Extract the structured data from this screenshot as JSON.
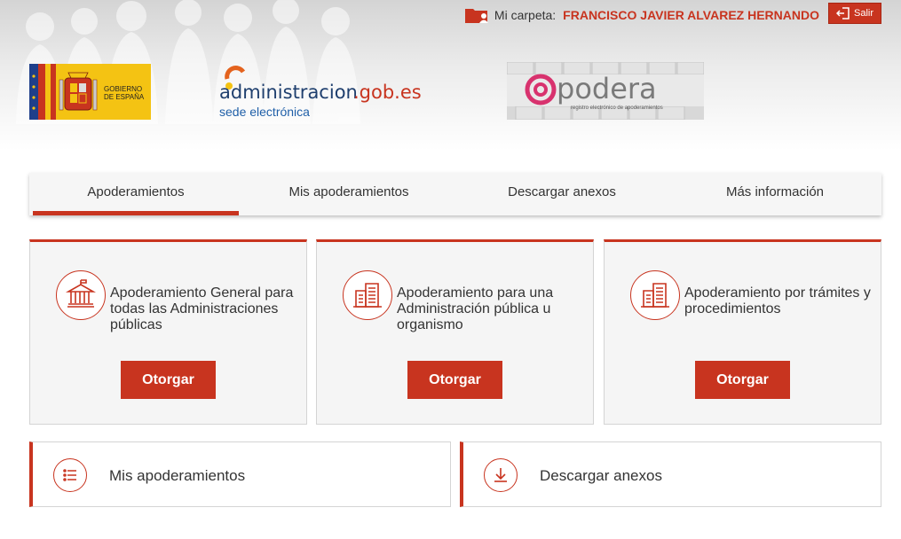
{
  "header": {
    "folder_label": "Mi carpeta:",
    "user_name": "FRANCISCO JAVIER ALVAREZ HERNANDO",
    "logout_label": "Salir"
  },
  "logos": {
    "gobierno_line1": "GOBIERNO",
    "gobierno_line2": "DE ESPAÑA",
    "admin_main": "administracion",
    "admin_domain": ".gob.es",
    "admin_sub": "sede electrónica",
    "apodera_name": "podera",
    "apodera_sub": "registro electrónico de apoderamientos"
  },
  "nav": {
    "tabs": [
      {
        "label": "Apoderamientos"
      },
      {
        "label": "Mis apoderamientos"
      },
      {
        "label": "Descargar anexos"
      },
      {
        "label": "Más información"
      }
    ]
  },
  "cards": [
    {
      "title": "Apoderamiento General para todas las Administraciones públicas",
      "button": "Otorgar",
      "icon": "government-building-icon"
    },
    {
      "title": "Apoderamiento para una Administración pública u organismo",
      "button": "Otorgar",
      "icon": "office-building-icon"
    },
    {
      "title": "Apoderamiento por trámites y procedimientos",
      "button": "Otorgar",
      "icon": "office-building-icon"
    }
  ],
  "links": [
    {
      "label": "Mis apoderamientos",
      "icon": "list-icon"
    },
    {
      "label": "Descargar anexos",
      "icon": "download-icon"
    }
  ],
  "colors": {
    "accent": "#c8341f",
    "card_bg": "#f5f5f5",
    "nav_bg": "#f6f6f6"
  }
}
